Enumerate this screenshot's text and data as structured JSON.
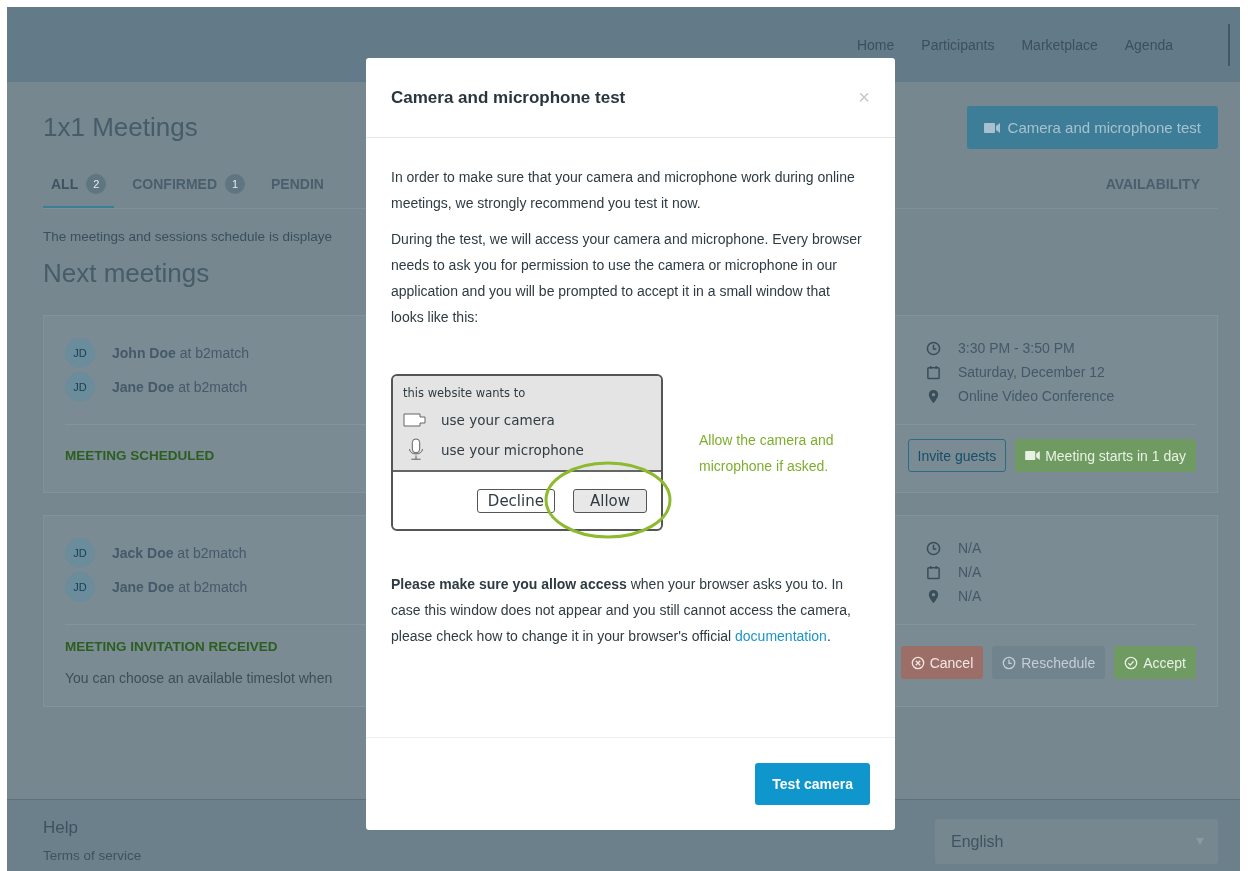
{
  "nav": {
    "links": [
      "Home",
      "Participants",
      "Marketplace",
      "Agenda"
    ]
  },
  "page": {
    "title": "1x1 Meetings",
    "camera_test_button": "Camera and microphone test",
    "tabs": [
      {
        "label": "ALL",
        "count": "2",
        "selected": true
      },
      {
        "label": "CONFIRMED",
        "count": "1",
        "selected": false
      },
      {
        "label": "PENDIN",
        "selected": false
      }
    ],
    "availability_tab": "AVAILABILITY",
    "info": "The meetings and sessions schedule is displaye",
    "section_title": "Next meetings"
  },
  "meetings": [
    {
      "participants": [
        {
          "initials": "JD",
          "name": "**John Doe** at b2match"
        },
        {
          "initials": "JD",
          "name": "**Jane Doe** at b2match"
        }
      ],
      "details": [
        {
          "kind": "time",
          "text": "3:30 PM - 3:50 PM"
        },
        {
          "kind": "date",
          "text": "Saturday, December 12"
        },
        {
          "kind": "place",
          "text": "Online Video Conference"
        }
      ],
      "status": "MEETING SCHEDULED",
      "buttons": [
        {
          "kind": "outline",
          "label": "Invite guests",
          "disabled": false
        },
        {
          "kind": "video",
          "label": "Meeting starts in 1 day",
          "disabled": false
        }
      ]
    },
    {
      "participants": [
        {
          "initials": "JD",
          "name": "**Jack Doe** at b2match"
        },
        {
          "initials": "JD",
          "name": "**Jane Doe** at b2match"
        }
      ],
      "details": [
        {
          "kind": "time",
          "text": "N/A"
        },
        {
          "kind": "date",
          "text": "N/A"
        },
        {
          "kind": "place",
          "text": "N/A"
        }
      ],
      "status": "MEETING INVITATION RECEIVED",
      "note": "You can choose an available timeslot when",
      "buttons": [
        {
          "kind": "cancel",
          "label": "Cancel",
          "disabled": false
        },
        {
          "kind": "reschedule",
          "label": "Reschedule",
          "disabled": true
        },
        {
          "kind": "accept",
          "label": "Accept",
          "disabled": false
        }
      ]
    }
  ],
  "footer": {
    "title": "Help",
    "link": "Terms of service",
    "language": "English"
  },
  "modal": {
    "title": "Camera and microphone test",
    "close": "×",
    "paragraphs": [
      "In order to make sure that your camera and microphone work during online meetings, we strongly recommend you test it now.",
      "During the test, we will access your camera and microphone. Every browser needs to ask you for permission to use the camera or microphone in our application and you will be prompted to accept it in a small window that looks like this:"
    ],
    "illustration": {
      "heading": "this website wants to",
      "camera": "use your camera",
      "microphone": "use your microphone",
      "decline": "Decline",
      "allow": "Allow"
    },
    "hint": "Allow the camera and microphone if asked.",
    "closing": {
      "text": "**Please make sure you allow access** when your browser asks you to. In case this window does not appear and you still cannot access the camera, please check how to change it in your browser's official",
      "link": "documentation",
      "after": "."
    },
    "button": "Test camera"
  }
}
